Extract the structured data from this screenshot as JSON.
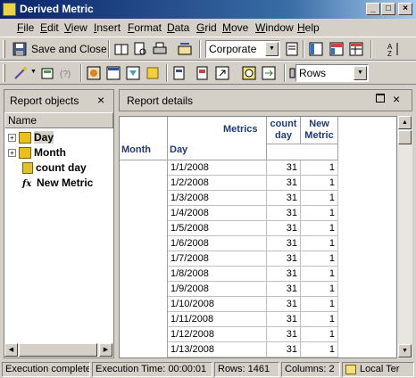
{
  "window": {
    "title": "Derived Metric"
  },
  "menu": [
    "File",
    "Edit",
    "View",
    "Insert",
    "Format",
    "Data",
    "Grid",
    "Move",
    "Window",
    "Help"
  ],
  "toolbar1": {
    "save_close_label": "Save and Close",
    "template_value": "Corporate"
  },
  "toolbar2": {
    "axis_value": "Rows"
  },
  "left_panel": {
    "title": "Report objects",
    "column_header": "Name",
    "items": [
      {
        "label": "Day",
        "icon": "attribute-icon",
        "selected": true
      },
      {
        "label": "Month",
        "icon": "attribute-icon",
        "selected": false
      },
      {
        "label": "count day",
        "icon": "metric-icon",
        "selected": false
      },
      {
        "label": "New Metric",
        "icon": "derived-metric-icon",
        "selected": false
      }
    ]
  },
  "right_panel": {
    "title": "Report details",
    "grid": {
      "row_header_month": "Month",
      "row_header_day": "Day",
      "metrics_label": "Metrics",
      "col_count_day": "count day",
      "col_new_metric": "New Metric",
      "rows": [
        {
          "day": "1/1/2008",
          "count_day": "31",
          "new_metric": "1"
        },
        {
          "day": "1/2/2008",
          "count_day": "31",
          "new_metric": "1"
        },
        {
          "day": "1/3/2008",
          "count_day": "31",
          "new_metric": "1"
        },
        {
          "day": "1/4/2008",
          "count_day": "31",
          "new_metric": "1"
        },
        {
          "day": "1/5/2008",
          "count_day": "31",
          "new_metric": "1"
        },
        {
          "day": "1/6/2008",
          "count_day": "31",
          "new_metric": "1"
        },
        {
          "day": "1/7/2008",
          "count_day": "31",
          "new_metric": "1"
        },
        {
          "day": "1/8/2008",
          "count_day": "31",
          "new_metric": "1"
        },
        {
          "day": "1/9/2008",
          "count_day": "31",
          "new_metric": "1"
        },
        {
          "day": "1/10/2008",
          "count_day": "31",
          "new_metric": "1"
        },
        {
          "day": "1/11/2008",
          "count_day": "31",
          "new_metric": "1"
        },
        {
          "day": "1/12/2008",
          "count_day": "31",
          "new_metric": "1"
        },
        {
          "day": "1/13/2008",
          "count_day": "31",
          "new_metric": "1"
        }
      ]
    }
  },
  "status": {
    "state": "Execution complete",
    "time": "Execution Time: 00:00:01",
    "rows": "Rows: 1461",
    "columns": "Columns: 2",
    "local": "Local Ter"
  }
}
